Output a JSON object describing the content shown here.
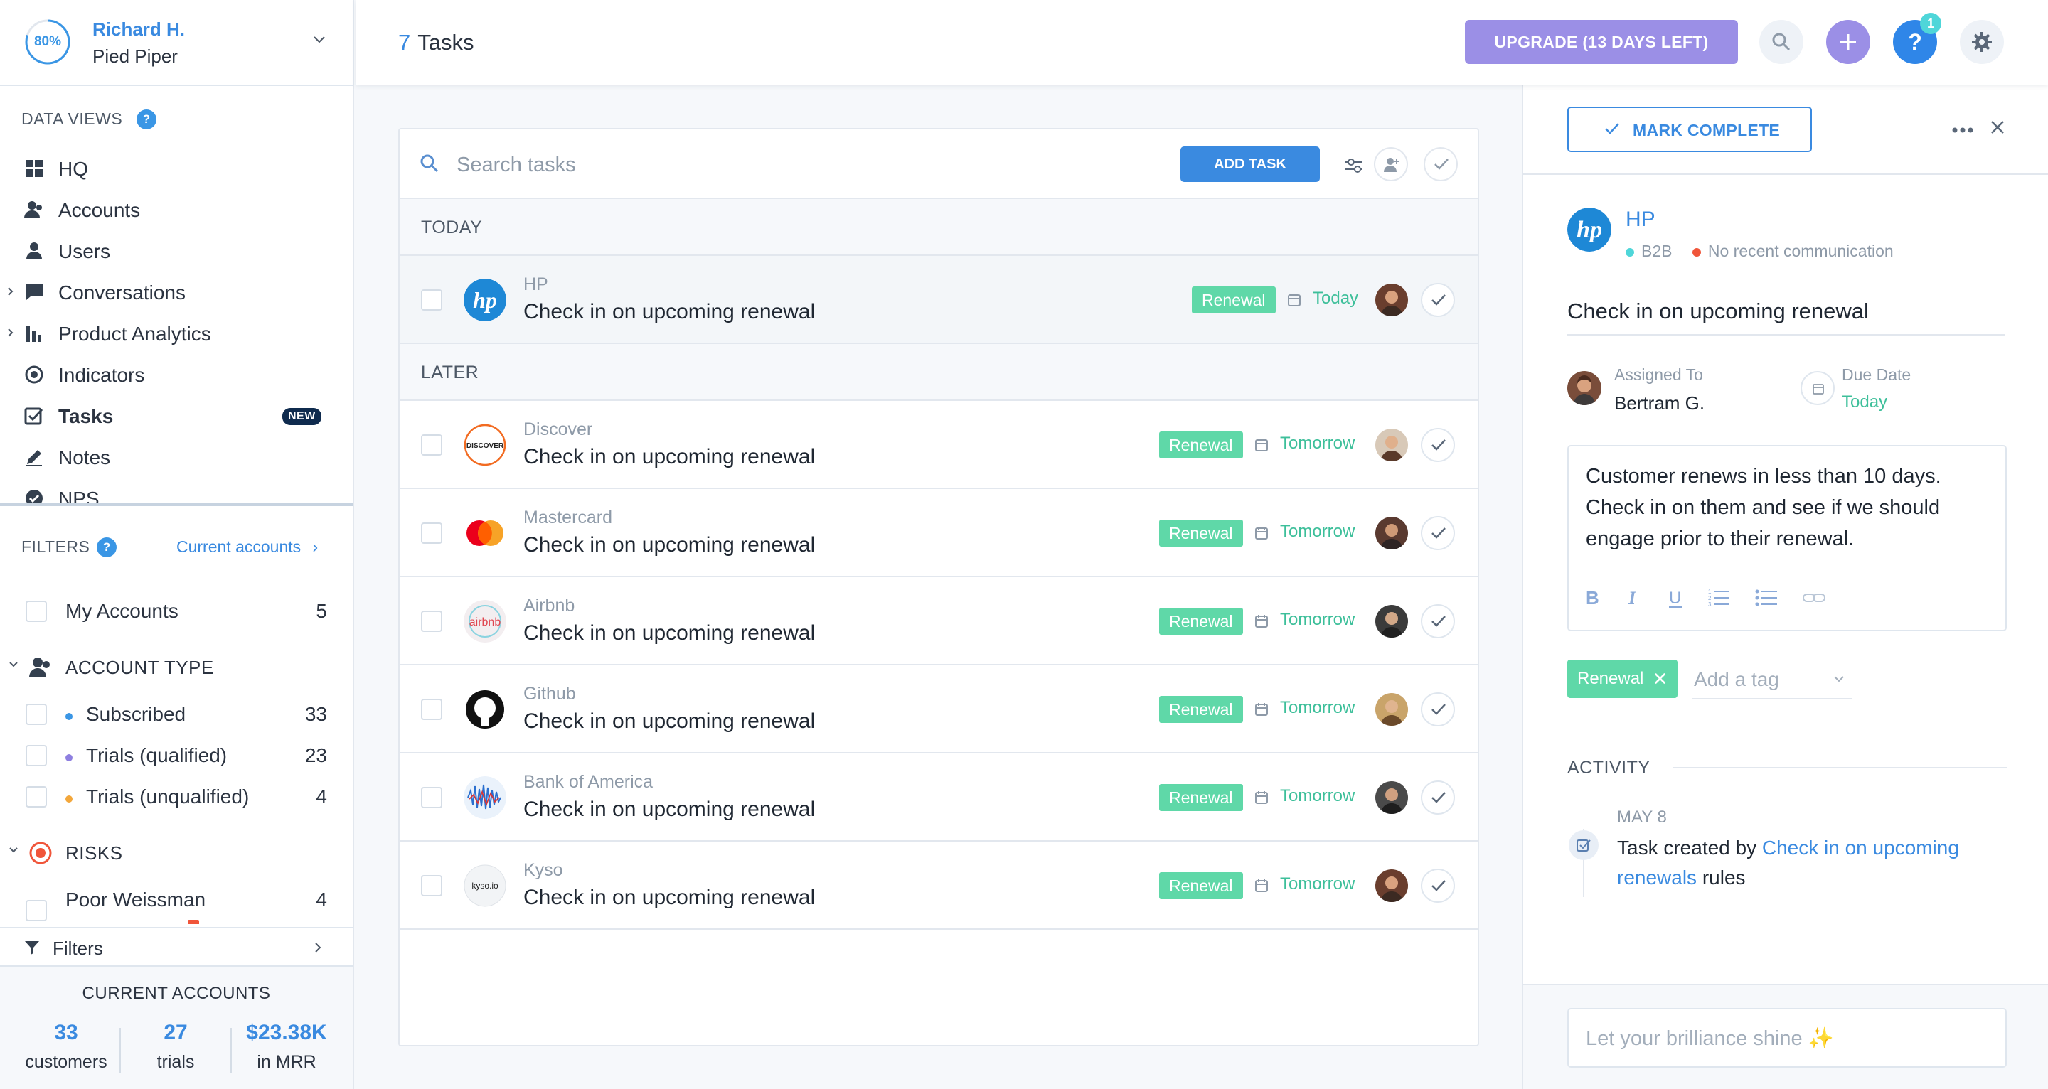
{
  "account": {
    "progress_label": "80%",
    "progress_fraction": 0.8,
    "user": "Richard H.",
    "org": "Pied Piper"
  },
  "data_views": {
    "label": "DATA VIEWS",
    "help": "?",
    "items": [
      {
        "label": "HQ",
        "icon": "grid-icon"
      },
      {
        "label": "Accounts",
        "icon": "accounts-icon"
      },
      {
        "label": "Users",
        "icon": "user-icon"
      },
      {
        "label": "Conversations",
        "icon": "chat-icon"
      },
      {
        "label": "Product Analytics",
        "icon": "bar-chart-icon"
      },
      {
        "label": "Indicators",
        "icon": "target-icon"
      },
      {
        "label": "Tasks",
        "icon": "tasks-icon",
        "badge": "NEW"
      },
      {
        "label": "Notes",
        "icon": "pencil-icon"
      },
      {
        "label": "NPS",
        "icon": "nps-icon"
      }
    ]
  },
  "filters": {
    "label": "FILTERS",
    "help": "?",
    "link": "Current accounts",
    "my_accounts": {
      "label": "My Accounts",
      "count": "5"
    },
    "account_type": {
      "label": "ACCOUNT TYPE",
      "items": [
        {
          "label": "Subscribed",
          "count": "33",
          "color": "#3a96e5"
        },
        {
          "label": "Trials (qualified)",
          "count": "23",
          "color": "#8e7fe0"
        },
        {
          "label": "Trials (unqualified)",
          "count": "4",
          "color": "#f3a73b"
        }
      ]
    },
    "risks": {
      "label": "RISKS",
      "items": [
        {
          "label": "Poor Weissman",
          "count": "4"
        }
      ]
    },
    "bar_label": "Filters"
  },
  "stats": {
    "title": "CURRENT ACCOUNTS",
    "items": [
      {
        "value": "33",
        "label": "customers"
      },
      {
        "value": "27",
        "label": "trials"
      },
      {
        "value": "$23.38K",
        "label": "in MRR"
      }
    ]
  },
  "topbar": {
    "count": "7",
    "title": "Tasks",
    "upgrade": "UPGRADE (13 DAYS LEFT)",
    "notif_count": "1",
    "help": "?"
  },
  "tasks": {
    "search_placeholder": "Search tasks",
    "add_task": "ADD TASK",
    "groups": {
      "today": "TODAY",
      "later": "LATER"
    },
    "rows": [
      {
        "company": "HP",
        "title": "Check in on upcoming renewal",
        "tag": "Renewal",
        "due": "Today",
        "logo": "hp"
      },
      {
        "company": "Discover",
        "title": "Check in on upcoming renewal",
        "tag": "Renewal",
        "due": "Tomorrow",
        "logo": "discover",
        "logo_text": "DISCOVER"
      },
      {
        "company": "Mastercard",
        "title": "Check in on upcoming renewal",
        "tag": "Renewal",
        "due": "Tomorrow",
        "logo": "mastercard"
      },
      {
        "company": "Airbnb",
        "title": "Check in on upcoming renewal",
        "tag": "Renewal",
        "due": "Tomorrow",
        "logo": "airbnb",
        "logo_text": "airbnb"
      },
      {
        "company": "Github",
        "title": "Check in on upcoming renewal",
        "tag": "Renewal",
        "due": "Tomorrow",
        "logo": "github"
      },
      {
        "company": "Bank of America",
        "title": "Check in on upcoming renewal",
        "tag": "Renewal",
        "due": "Tomorrow",
        "logo": "boa"
      },
      {
        "company": "Kyso",
        "title": "Check in on upcoming renewal",
        "tag": "Renewal",
        "due": "Tomorrow",
        "logo": "kyso",
        "logo_text": "kyso.io"
      }
    ]
  },
  "detail": {
    "mark_complete": "MARK COMPLETE",
    "company": "HP",
    "segment": "B2B",
    "communication": "No recent communication",
    "title": "Check in on upcoming renewal",
    "assigned_label": "Assigned To",
    "assigned_value": "Bertram G.",
    "due_label": "Due Date",
    "due_value": "Today",
    "description": "Customer renews in less than 10 days. Check in on them and see if we should engage prior to their renewal.",
    "tag": "Renewal",
    "tag_remove": "✕",
    "add_tag": "Add a tag",
    "activity_label": "ACTIVITY",
    "activity": {
      "date": "MAY 8",
      "prefix": "Task created by ",
      "link": "Check in on upcoming renewals",
      "suffix": " rules"
    },
    "compose_placeholder": "Let your brilliance shine ✨"
  },
  "colors": {
    "accent": "#3a8ae0",
    "tag_green": "#5fd8a8",
    "upgrade_purple": "#9b8fe6",
    "risk_red": "#f0553a"
  }
}
